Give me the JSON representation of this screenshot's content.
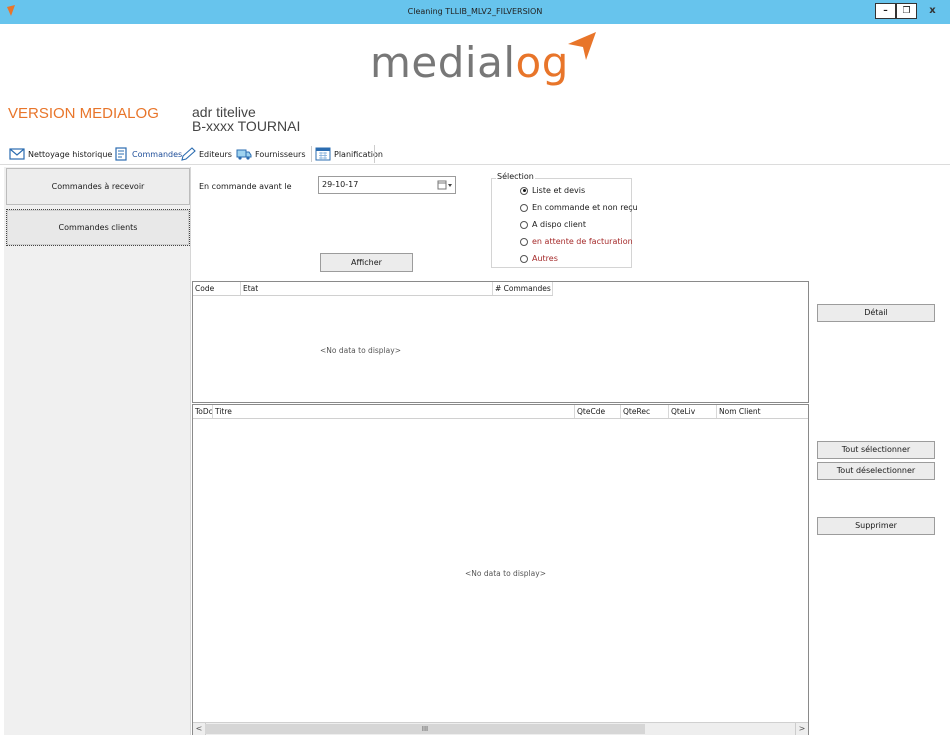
{
  "window": {
    "title": "Cleaning TLLIB_MLV2_FILVERSION",
    "minimize": "–",
    "maximize": "❐",
    "close": "x"
  },
  "logo": {
    "text_main": "medial",
    "text_accent": "og"
  },
  "header": {
    "version": "VERSION MEDIALOG",
    "address_line1": "adr titelive",
    "address_line2": "B-xxxx TOURNAI"
  },
  "toolbar": {
    "items": [
      {
        "label": "Nettoyage historique",
        "icon": "envelope-icon"
      },
      {
        "label": "Commandes",
        "icon": "document-icon",
        "active": true
      },
      {
        "label": "Editeurs",
        "icon": "pencil-icon"
      },
      {
        "label": "Fournisseurs",
        "icon": "truck-icon"
      },
      {
        "label": "Planification",
        "icon": "calendar-icon"
      }
    ]
  },
  "nav": {
    "items": [
      {
        "label": "Commandes à recevoir"
      },
      {
        "label": "Commandes clients",
        "selected": true
      }
    ]
  },
  "filter": {
    "date_label": "En commande avant le",
    "date_value": "29-10-17",
    "show_button": "Afficher"
  },
  "selection": {
    "legend": "Sélection",
    "options": [
      {
        "label": "Liste et devis",
        "checked": true
      },
      {
        "label": "En commande et non reçu"
      },
      {
        "label": "A dispo client"
      },
      {
        "label": "en attente de facturation",
        "color": "#a52a2a"
      },
      {
        "label": "Autres",
        "color": "#a52a2a"
      }
    ]
  },
  "grid_orders": {
    "columns": [
      "Code",
      "Etat",
      "# Commandes"
    ],
    "empty_text": "<No data to display>"
  },
  "grid_lines": {
    "columns": [
      "ToDc",
      "Titre",
      "QteCde",
      "QteRec",
      "QteLiv",
      "Nom Client"
    ],
    "empty_text": "<No data to display>"
  },
  "scrollbar": {
    "left": "<",
    "right": ">",
    "grip": "III"
  },
  "actions": {
    "detail": "Détail",
    "select_all": "Tout sélectionner",
    "deselect_all": "Tout déselectionner",
    "delete": "Supprimer"
  },
  "colors": {
    "titlebar": "#67c4ed",
    "accent": "#e8752a",
    "logo_gray": "#777777"
  }
}
